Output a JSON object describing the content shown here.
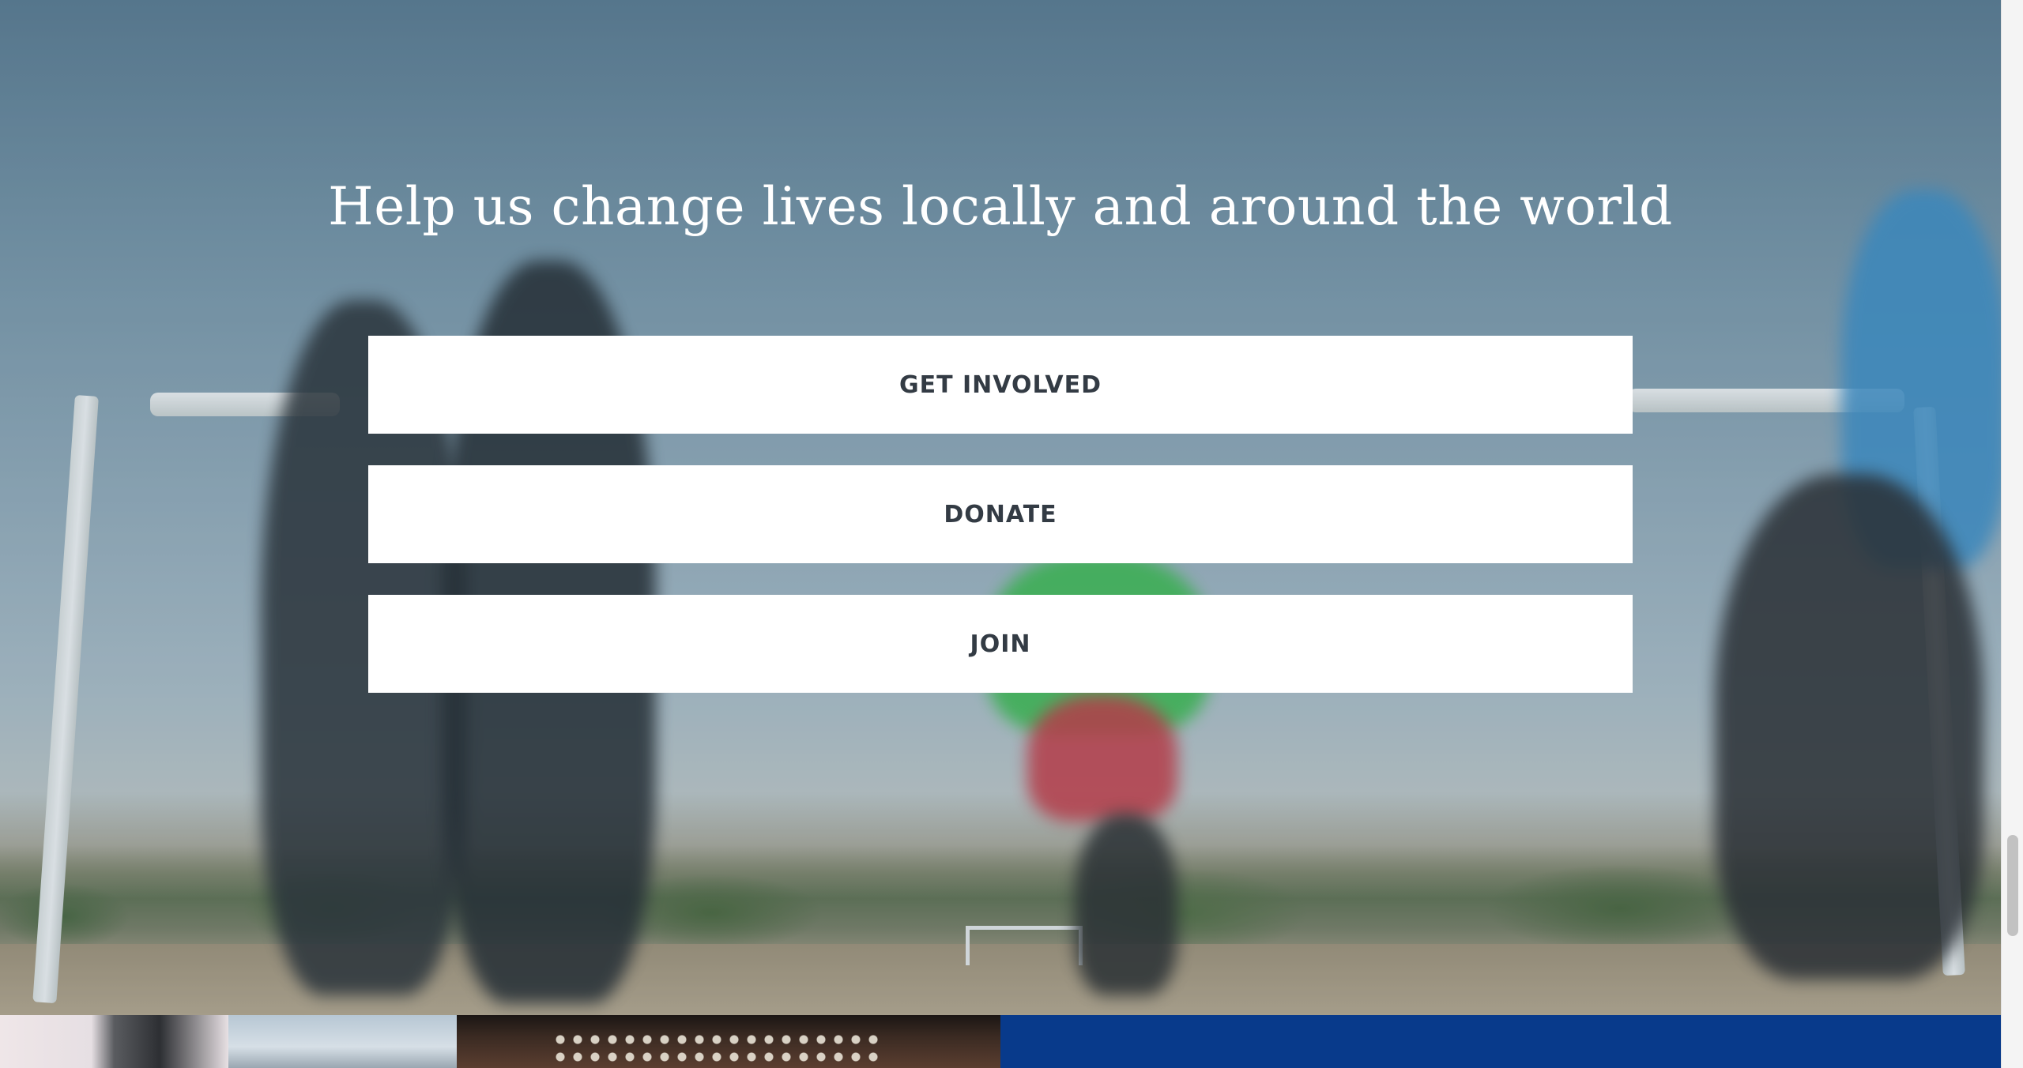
{
  "hero": {
    "headline": "Help us change lives locally and around the world",
    "image_description_icon": "soccer-players-photo"
  },
  "actions": {
    "get_involved_label": "GET INVOLVED",
    "donate_label": "DONATE",
    "join_label": "JOIN"
  },
  "colors": {
    "button_background": "#ffffff",
    "button_text": "#333b44",
    "headline_text": "#ffffff",
    "bottom_tile_blue": "#083a8b"
  }
}
